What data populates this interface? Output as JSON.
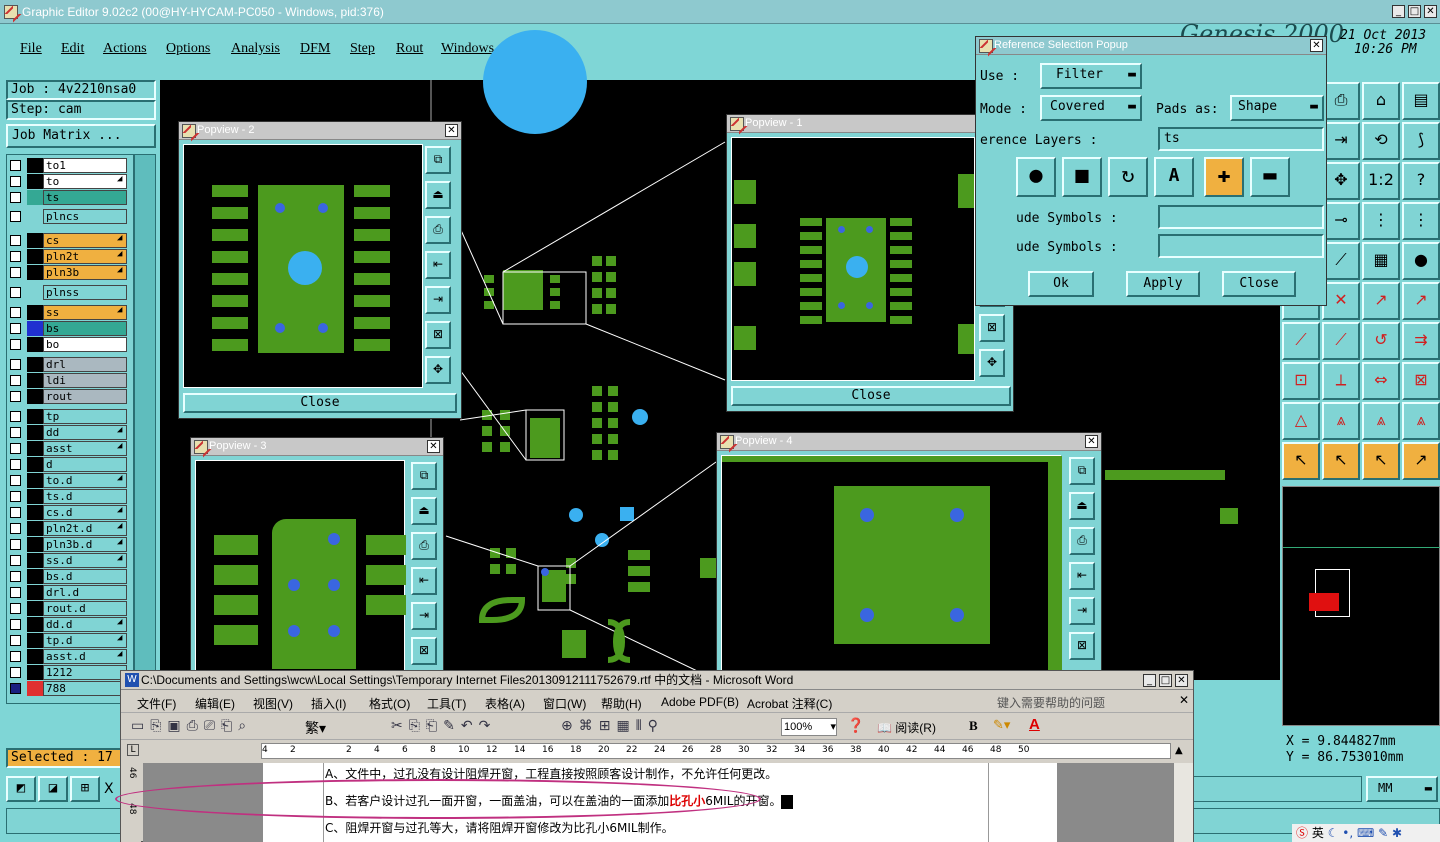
{
  "app": {
    "title": "Graphic Editor 9.02c2 (00@HY-HYCAM-PC050 - Windows, pid:376)",
    "date": "21 Oct 2013",
    "time": "10:26 PM",
    "date_prefix": "Genesis 2000"
  },
  "menu": [
    "File",
    "Edit",
    "Actions",
    "Options",
    "Analysis",
    "DFM",
    "Step",
    "Rout",
    "Windows"
  ],
  "job": {
    "job": "Job : 4v2210nsa0",
    "step": "Step: cam",
    "matrix_btn": "Job Matrix ..."
  },
  "layers": [
    {
      "name": "to1",
      "color": "#ffffff",
      "sw": "#000000",
      "mark": ""
    },
    {
      "name": "to",
      "color": "#ffffff",
      "sw": "#000000",
      "mark": "◢"
    },
    {
      "name": "ts",
      "color": "#34a894",
      "sw": "#34a894",
      "mark": ""
    },
    {
      "name": "plncs",
      "color": "#80d4d4",
      "sw": "#80d4d4",
      "mark": ""
    },
    {
      "name": "cs",
      "color": "#f0b040",
      "sw": "#000000",
      "mark": "◢"
    },
    {
      "name": "pln2t",
      "color": "#f0b040",
      "sw": "#000000",
      "mark": "◢"
    },
    {
      "name": "pln3b",
      "color": "#f0b040",
      "sw": "#000000",
      "mark": "◢"
    },
    {
      "name": "plnss",
      "color": "#80d4d4",
      "sw": "#80d4d4",
      "mark": ""
    },
    {
      "name": "ss",
      "color": "#f0b040",
      "sw": "#000000",
      "mark": "◢"
    },
    {
      "name": "bs",
      "color": "#34a894",
      "sw": "#2030d0",
      "mark": ""
    },
    {
      "name": "bo",
      "color": "#ffffff",
      "sw": "#000000",
      "mark": ""
    },
    {
      "name": "drl",
      "color": "#aab8c0",
      "sw": "#000000",
      "mark": ""
    },
    {
      "name": "ldi",
      "color": "#aab8c0",
      "sw": "#000000",
      "mark": ""
    },
    {
      "name": "rout",
      "color": "#aab8c0",
      "sw": "#000000",
      "mark": ""
    },
    {
      "name": "tp",
      "color": "#80d4d4",
      "sw": "#000000",
      "mark": ""
    },
    {
      "name": "dd",
      "color": "#80d4d4",
      "sw": "#000000",
      "mark": "◢"
    },
    {
      "name": "asst",
      "color": "#80d4d4",
      "sw": "#000000",
      "mark": "◢"
    },
    {
      "name": "d",
      "color": "#80d4d4",
      "sw": "#000000",
      "mark": ""
    },
    {
      "name": "to.d",
      "color": "#80d4d4",
      "sw": "#000000",
      "mark": "◢"
    },
    {
      "name": "ts.d",
      "color": "#80d4d4",
      "sw": "#000000",
      "mark": ""
    },
    {
      "name": "cs.d",
      "color": "#80d4d4",
      "sw": "#000000",
      "mark": "◢"
    },
    {
      "name": "pln2t.d",
      "color": "#80d4d4",
      "sw": "#000000",
      "mark": "◢"
    },
    {
      "name": "pln3b.d",
      "color": "#80d4d4",
      "sw": "#000000",
      "mark": "◢"
    },
    {
      "name": "ss.d",
      "color": "#80d4d4",
      "sw": "#000000",
      "mark": "◢"
    },
    {
      "name": "bs.d",
      "color": "#80d4d4",
      "sw": "#000000",
      "mark": ""
    },
    {
      "name": "drl.d",
      "color": "#80d4d4",
      "sw": "#000000",
      "mark": ""
    },
    {
      "name": "rout.d",
      "color": "#80d4d4",
      "sw": "#000000",
      "mark": ""
    },
    {
      "name": "dd.d",
      "color": "#80d4d4",
      "sw": "#000000",
      "mark": "◢"
    },
    {
      "name": "tp.d",
      "color": "#80d4d4",
      "sw": "#000000",
      "mark": "◢"
    },
    {
      "name": "asst.d",
      "color": "#80d4d4",
      "sw": "#000000",
      "mark": "◢"
    },
    {
      "name": "1212",
      "color": "#80d4d4",
      "sw": "#000000",
      "mark": ""
    },
    {
      "name": "788",
      "color": "#80d4d4",
      "sw": "#e03030",
      "mark": ""
    }
  ],
  "selected": "Selected : 17",
  "popviews": {
    "p1": "Popview - 1",
    "p2": "Popview - 2",
    "p3": "Popview - 3",
    "p4": "Popview - 4",
    "close": "Close"
  },
  "ref": {
    "title": "Reference Selection Popup",
    "use_label": "Use  :",
    "use_val": "Filter",
    "mode_label": "Mode :",
    "mode_val": "Covered",
    "pads_label": "Pads as:",
    "pads_val": "Shape",
    "ref_layers_label": "erence Layers :",
    "ref_layers_val": "ts",
    "inc_label": "ude Symbols :",
    "exc_label": "ude Symbols :",
    "ok": "Ok",
    "apply": "Apply",
    "close": "Close"
  },
  "coords": {
    "x": "X = 9.844827mm",
    "y": "Y = 86.753010mm",
    "units": "MM"
  },
  "word": {
    "title": "C:\\Documents and Settings\\wcw\\Local Settings\\Temporary Internet Files20130912111752679.rtf 中的文档 - Microsoft Word",
    "menu": [
      "文件(F)",
      "编辑(E)",
      "视图(V)",
      "插入(I)",
      "格式(O)",
      "工具(T)",
      "表格(A)",
      "窗口(W)",
      "帮助(H)",
      "Adobe PDF(B)",
      "Acrobat 注释(C)"
    ],
    "help_placeholder": "键入需要帮助的问题",
    "zoom": "100%",
    "read": "阅读(R)",
    "lines": [
      "A、文件中，过孔没有设计阻焊开窗，工程直接按照顾客设计制作，不允许任何更改。",
      "B、若客户设计过孔一面开窗，一面盖油，可以在盖油的一面添加",
      "比孔小",
      "6MIL的开窗。",
      "C、阻焊开窗与过孔等大，请将阻焊开窗修改为比孔小6MIL制作。"
    ],
    "ruler": [
      "4",
      "2",
      "",
      "2",
      "4",
      "6",
      "8",
      "10",
      "12",
      "14",
      "16",
      "18",
      "20",
      "22",
      "24",
      "26",
      "28",
      "30",
      "32",
      "34",
      "36",
      "38",
      "40",
      "42",
      "44",
      "46",
      "48",
      "50"
    ],
    "vruler": [
      "46",
      "48"
    ]
  },
  "tray": "英"
}
